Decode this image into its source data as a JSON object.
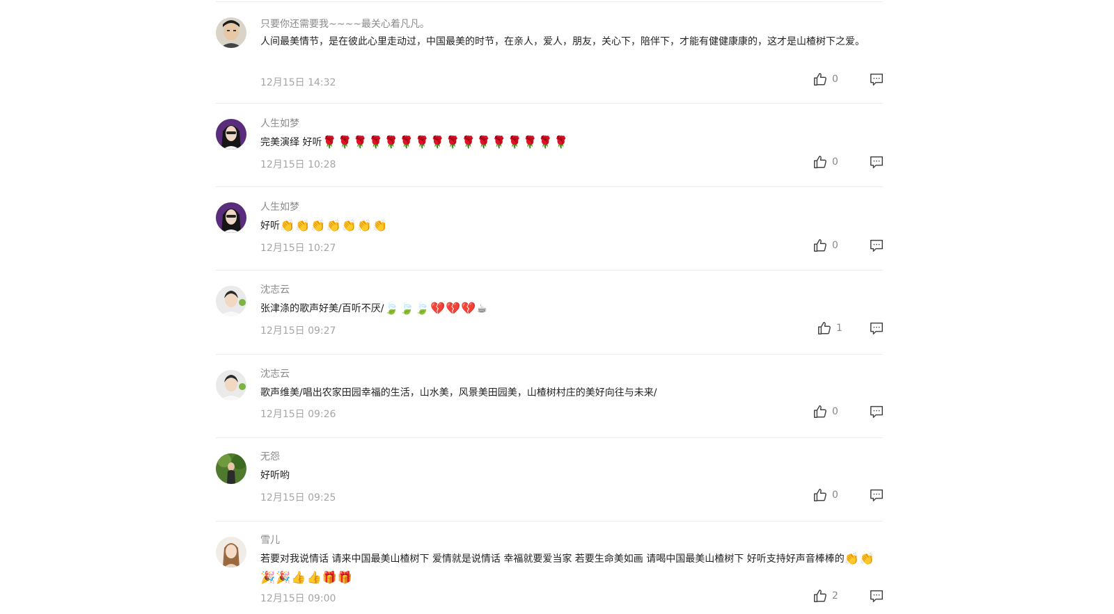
{
  "comments": [
    {
      "name": "只要你还需要我~~~~最关心着凡凡。",
      "text": "人间最美情节，是在彼此心里走动过，中国最美的时节，在亲人，爱人，朋友，关心下，陪伴下，才能有健健康康的，这才是山楂树下之爱。",
      "emoji": "",
      "time": "12月15日 14:32",
      "likes": "0"
    },
    {
      "name": "人生如梦",
      "text": "完美演绎 好听",
      "emoji": "🌹🌹🌹🌹🌹🌹🌹🌹🌹🌹🌹🌹🌹🌹🌹🌹",
      "time": "12月15日 10:28",
      "likes": "0"
    },
    {
      "name": "人生如梦",
      "text": "好听",
      "emoji": "👏👏👏👏👏👏👏",
      "time": "12月15日 10:27",
      "likes": "0"
    },
    {
      "name": "沈志云",
      "text": "张津涤的歌声好美/百听不厌/",
      "emoji": "🍃🍃🍃💔💔💔☕",
      "time": "12月15日 09:27",
      "likes": "1"
    },
    {
      "name": "沈志云",
      "text": "歌声维美/唱出农家田园幸福的生活，山水美，风景美田园美，山楂树村庄的美好向往与未来/",
      "emoji": "",
      "time": "12月15日 09:26",
      "likes": "0"
    },
    {
      "name": "无怨",
      "text": "好听哟",
      "emoji": "",
      "time": "12月15日 09:25",
      "likes": "0"
    },
    {
      "name": "雪儿",
      "text": "若要对我说情话 请来中国最美山楂树下 爱情就是说情话 幸福就要爱当家 若要生命美如画 请喝中国最美山楂树下 好听支持好声音棒棒的",
      "emoji": "👏👏🎉🎉👍👍🎁🎁",
      "time": "12月15日 09:00",
      "likes": "2"
    }
  ],
  "icons": {
    "like": "thumbs-up-icon",
    "reply": "comment-bubble-icon"
  },
  "colors": {
    "name": "#8a8a8a",
    "text": "#222222",
    "time": "#a5a5a5",
    "divider": "#ececec",
    "icon": "#444444"
  }
}
